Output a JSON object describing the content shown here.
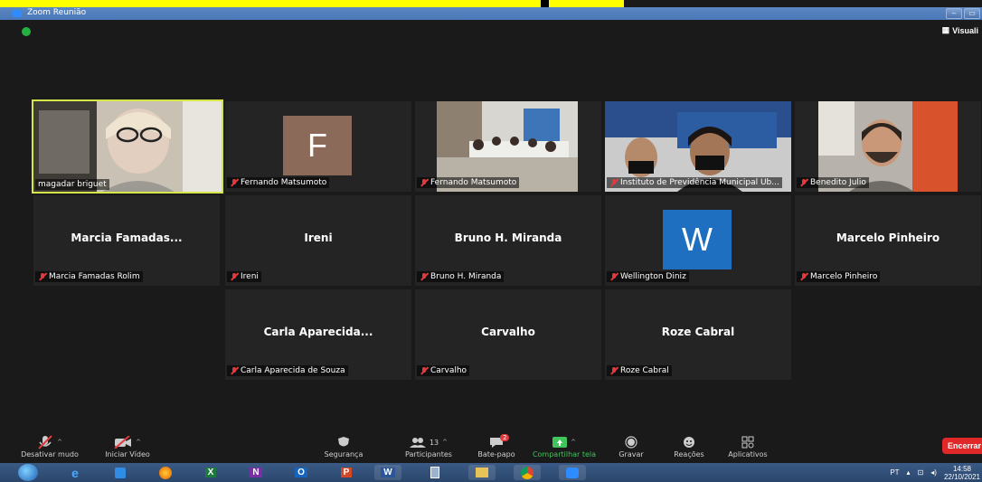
{
  "window": {
    "title": "Zoom Reunião",
    "view_label": "Visuali"
  },
  "participants_grid": [
    {
      "id": "t1",
      "name": "magadar briguet",
      "muted": false,
      "type": "video",
      "active": true
    },
    {
      "id": "t2",
      "name": "Fernando Matsumoto",
      "muted": true,
      "type": "avatar",
      "avatar_letter": "F",
      "avatar_color": "#8b6a5a"
    },
    {
      "id": "t3",
      "name": "Fernando Matsumoto",
      "muted": true,
      "type": "video"
    },
    {
      "id": "t4",
      "name": "Instituto de Previdência Municipal Ub...",
      "muted": true,
      "type": "video"
    },
    {
      "id": "t5",
      "name": "Benedito Julio",
      "muted": true,
      "type": "video"
    },
    {
      "id": "t6",
      "name": "Marcia Famadas Rolim",
      "display": "Marcia Famadas...",
      "muted": true,
      "type": "name"
    },
    {
      "id": "t7",
      "name": "Ireni",
      "display": "Ireni",
      "muted": true,
      "type": "name"
    },
    {
      "id": "t8",
      "name": "Bruno H. Miranda",
      "display": "Bruno H. Miranda",
      "muted": true,
      "type": "name"
    },
    {
      "id": "t9",
      "name": "Wellington Diniz",
      "muted": true,
      "type": "avatar",
      "avatar_letter": "W",
      "avatar_color": "#1e6fbf"
    },
    {
      "id": "t10",
      "name": "Marcelo Pinheiro",
      "display": "Marcelo Pinheiro",
      "muted": true,
      "type": "name"
    },
    {
      "id": "t11",
      "name": "Carla Aparecida de Souza",
      "display": "Carla Aparecida...",
      "muted": true,
      "type": "name"
    },
    {
      "id": "t12",
      "name": "Carvalho",
      "display": "Carvalho",
      "muted": true,
      "type": "name"
    },
    {
      "id": "t13",
      "name": "Roze Cabral",
      "display": "Roze Cabral",
      "muted": true,
      "type": "name"
    }
  ],
  "toolbar": {
    "mute": "Desativar mudo",
    "video": "Iniciar Vídeo",
    "security": "Segurança",
    "participants": "Participantes",
    "participants_count": "13",
    "chat": "Bate-papo",
    "chat_badge": "2",
    "share": "Compartilhar tela",
    "record": "Gravar",
    "reactions": "Reações",
    "apps": "Aplicativos",
    "end": "Encerrar"
  },
  "taskbar": {
    "apps": [
      "Windows Start",
      "Internet Explorer",
      "Windows Media Center",
      "Firefox",
      "Excel",
      "OneNote",
      "Outlook",
      "PowerPoint",
      "Word",
      "Calculator",
      "File Explorer",
      "Chrome",
      "Zoom"
    ],
    "lang": "PT",
    "time": "14:58",
    "date": "22/10/2021"
  },
  "colors": {
    "accent_active": "#d6e64a",
    "end_red": "#e02828",
    "share_green": "#3fc55b",
    "mute_red": "#e0393e"
  }
}
